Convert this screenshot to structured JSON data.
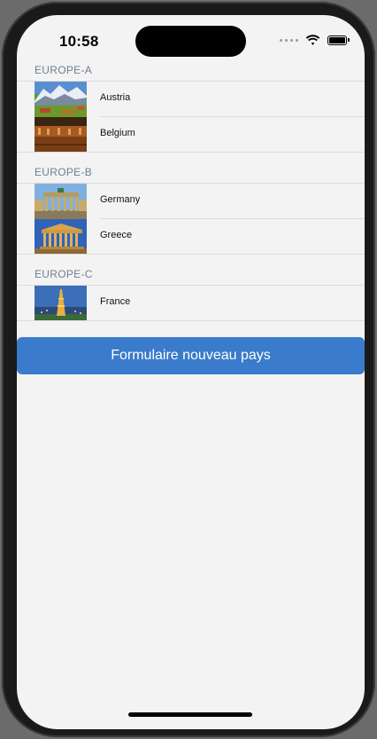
{
  "status_bar": {
    "time": "10:58"
  },
  "sections": [
    {
      "header": "EUROPE-A",
      "rows": [
        {
          "label": "Austria",
          "image": "austria-alps-photo"
        },
        {
          "label": "Belgium",
          "image": "belgium-square-photo"
        }
      ]
    },
    {
      "header": "EUROPE-B",
      "rows": [
        {
          "label": "Germany",
          "image": "brandenburg-gate-photo"
        },
        {
          "label": "Greece",
          "image": "parthenon-photo"
        }
      ]
    },
    {
      "header": "EUROPE-C",
      "rows": [
        {
          "label": "France",
          "image": "eiffel-tower-photo"
        }
      ]
    }
  ],
  "action_button": {
    "label": "Formulaire nouveau pays",
    "color": "#3a7bcb"
  }
}
